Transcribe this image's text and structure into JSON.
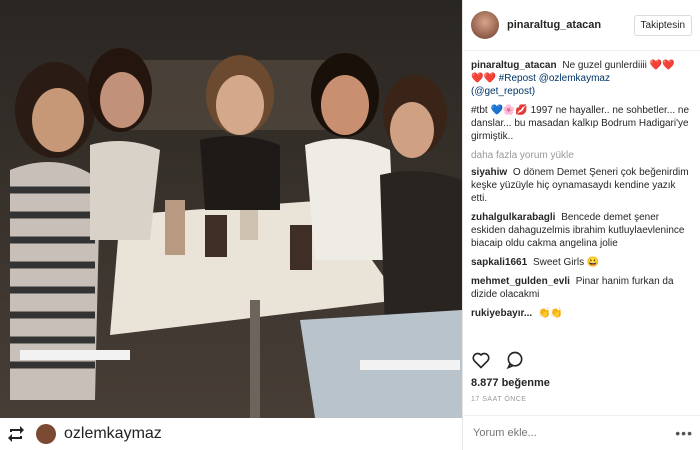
{
  "post": {
    "username": "pinaraltug_atacan",
    "follow_label": "Takiptesin",
    "caption_user": "pinaraltug_atacan",
    "caption_line1": "Ne guzel gunlerdiiii ❤️❤️",
    "caption_line2": "❤️❤️ #Repost @ozlemkaymaz",
    "caption_line3": "(@get_repost)",
    "caption_line4": "#tbt 💙🌸💋 1997 ne hayaller.. ne sohbetler... ne danslar... bu masadan kalkıp Bodrum Hadigari'ye girmiştik..",
    "load_more": "daha fazla yorum yükle",
    "comments": [
      {
        "user": "siyahiw",
        "text": "O dönem Demet Şeneri çok beğenirdim keşke yüzüyle hiç oynamasaydı kendine yazık etti."
      },
      {
        "user": "zuhalgulkarabagli",
        "text": "Bencede demet şener eskiden dahaguzelmis ibrahim kutluylaevlenince biacaip oldu cakma angelina jolie"
      },
      {
        "user": "sapkali1661",
        "text": "Sweet Girls 😀"
      },
      {
        "user": "mehmet_gulden_evli",
        "text": "Pinar hanim furkan da dizide olacakmi"
      },
      {
        "user": "rukiyebayır...",
        "text": "👏👏"
      }
    ],
    "likes": "8.877 beğenme",
    "time": "17 SAAT ÖNCE",
    "comment_placeholder": "Yorum ekle...",
    "more_icon": "•••"
  },
  "repost": {
    "username": "ozlemkaymaz"
  },
  "colors": {
    "link": "#003569",
    "muted": "#999999",
    "border": "#efefef"
  }
}
